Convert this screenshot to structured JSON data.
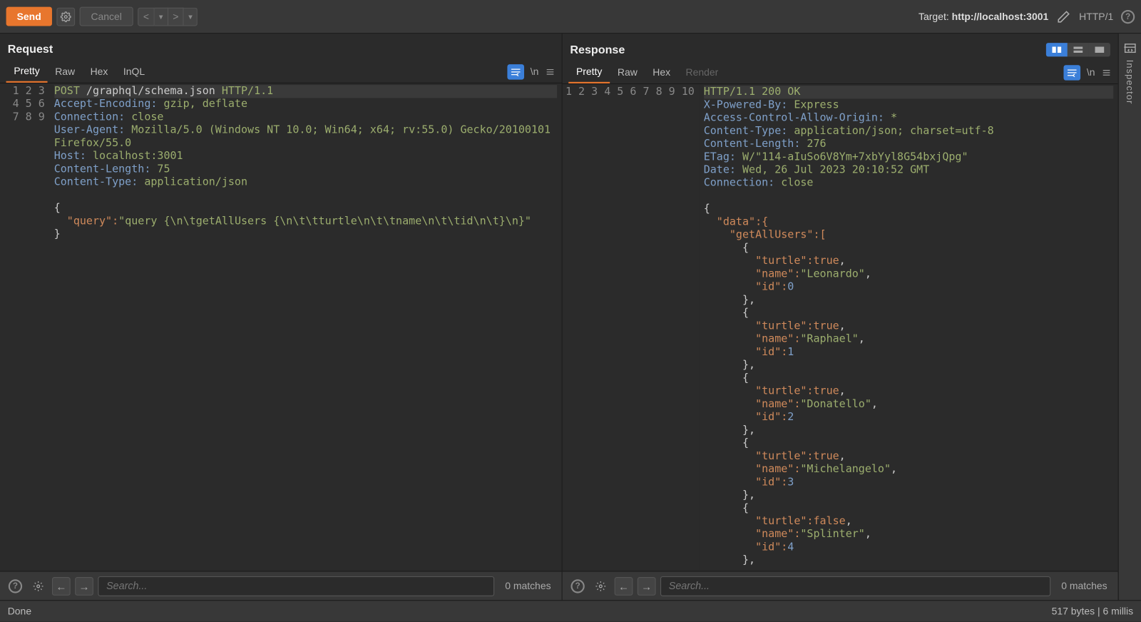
{
  "toolbar": {
    "send": "Send",
    "cancel": "Cancel",
    "target_label": "Target: ",
    "target_url": "http://localhost:3001",
    "protocol": "HTTP/1"
  },
  "request": {
    "title": "Request",
    "tabs": {
      "pretty": "Pretty",
      "raw": "Raw",
      "hex": "Hex",
      "inql": "InQL"
    },
    "newline_label": "\\n",
    "search_placeholder": "Search...",
    "matches": "0 matches",
    "lines": {
      "l1_method": "POST",
      "l1_path": " /graphql/schema.json ",
      "l1_proto": "HTTP/1.1",
      "l2_h": "Accept-Encoding:",
      "l2_v": " gzip, deflate",
      "l3_h": "Connection:",
      "l3_v": " close",
      "l4_h": "User-Agent:",
      "l4_v": " Mozilla/5.0 (Windows NT 10.0; Win64; x64; rv:55.0) Gecko/20100101 ",
      "l4b": "Firefox/55.0",
      "l5_h": "Host:",
      "l5_v": " localhost:3001",
      "l6_h": "Content-Length:",
      "l6_v": " 75",
      "l7_h": "Content-Type:",
      "l7_v": " application/json",
      "body_key": "\"query\"",
      "body_val": "\"query {\\n\\tgetAllUsers {\\n\\t\\tturtle\\n\\t\\tname\\n\\t\\tid\\n\\t}\\n}\""
    }
  },
  "response": {
    "title": "Response",
    "tabs": {
      "pretty": "Pretty",
      "raw": "Raw",
      "hex": "Hex",
      "render": "Render"
    },
    "newline_label": "\\n",
    "search_placeholder": "Search...",
    "matches": "0 matches",
    "headers": {
      "l1": "HTTP/1.1 200 OK",
      "l2_h": "X-Powered-By:",
      "l2_v": " Express",
      "l3_h": "Access-Control-Allow-Origin:",
      "l3_v": " *",
      "l4_h": "Content-Type:",
      "l4_v": " application/json; charset=utf-8",
      "l5_h": "Content-Length:",
      "l5_v": " 276",
      "l6_h": "ETag:",
      "l6_v": " W/\"114-aIuSo6V8Ym+7xbYyl8G54bxjQpg\"",
      "l7_h": "Date:",
      "l7_v": " Wed, 26 Jul 2023 20:10:52 GMT",
      "l8_h": "Connection:",
      "l8_v": " close"
    },
    "body_keys": {
      "data": "\"data\"",
      "getAllUsers": "\"getAllUsers\"",
      "turtle": "\"turtle\"",
      "name": "\"name\"",
      "id": "\"id\""
    },
    "users": [
      {
        "turtle": "true",
        "name": "\"Leonardo\"",
        "id": "0"
      },
      {
        "turtle": "true",
        "name": "\"Raphael\"",
        "id": "1"
      },
      {
        "turtle": "true",
        "name": "\"Donatello\"",
        "id": "2"
      },
      {
        "turtle": "true",
        "name": "\"Michelangelo\"",
        "id": "3"
      },
      {
        "turtle": "false",
        "name": "\"Splinter\"",
        "id": "4"
      }
    ]
  },
  "inspector": {
    "label": "Inspector"
  },
  "status": {
    "left": "Done",
    "right": "517 bytes | 6 millis"
  }
}
